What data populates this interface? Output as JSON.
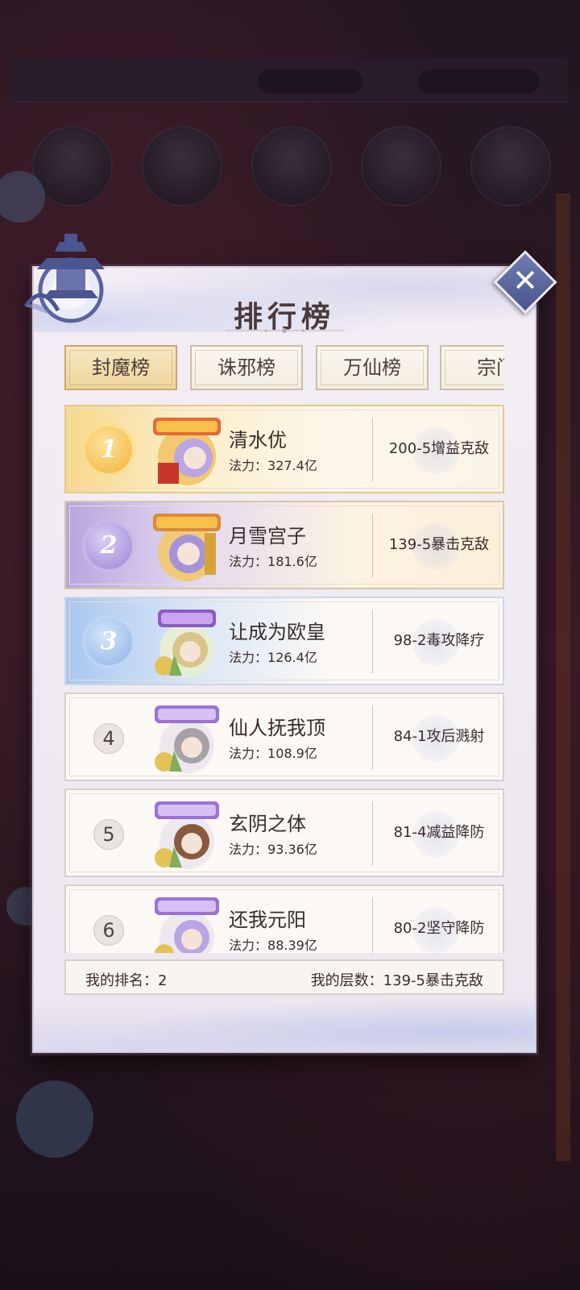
{
  "dialog": {
    "title": "排行榜"
  },
  "tabs": [
    {
      "label": "封魔榜",
      "active": true
    },
    {
      "label": "诛邪榜",
      "active": false
    },
    {
      "label": "万仙榜",
      "active": false
    },
    {
      "label": "宗门",
      "active": false
    }
  ],
  "rankings": [
    {
      "rank": "1",
      "name": "清水优",
      "power_label": "法力：",
      "power": "327.4亿",
      "floor": "200-5增益克敌",
      "badge_icon": "title-badge-gold-icon"
    },
    {
      "rank": "2",
      "name": "月雪宫子",
      "power_label": "法力：",
      "power": "181.6亿",
      "floor": "139-5暴击克敌",
      "badge_icon": "title-badge-gold-icon"
    },
    {
      "rank": "3",
      "name": "让成为欧皇",
      "power_label": "法力：",
      "power": "126.4亿",
      "floor": "98-2毒攻降疗",
      "badge_icon": "title-badge-purple-icon"
    },
    {
      "rank": "4",
      "name": "仙人抚我顶",
      "power_label": "法力：",
      "power": "108.9亿",
      "floor": "84-1攻后溅射",
      "badge_icon": "title-badge-purple-icon"
    },
    {
      "rank": "5",
      "name": "玄阴之体",
      "power_label": "法力：",
      "power": "93.36亿",
      "floor": "81-4减益降防",
      "badge_icon": "title-badge-purple-icon"
    },
    {
      "rank": "6",
      "name": "还我元阳",
      "power_label": "法力：",
      "power": "88.39亿",
      "floor": "80-2坚守降防",
      "badge_icon": "title-badge-purple-icon"
    }
  ],
  "footer": {
    "my_rank": "我的排名：2",
    "my_floor": "我的层数：139-5暴击克敌"
  },
  "colors": {
    "gold": "#f1b33a",
    "purple": "#9c86d4",
    "blue": "#8db3e6",
    "text": "#3b2c2c"
  }
}
